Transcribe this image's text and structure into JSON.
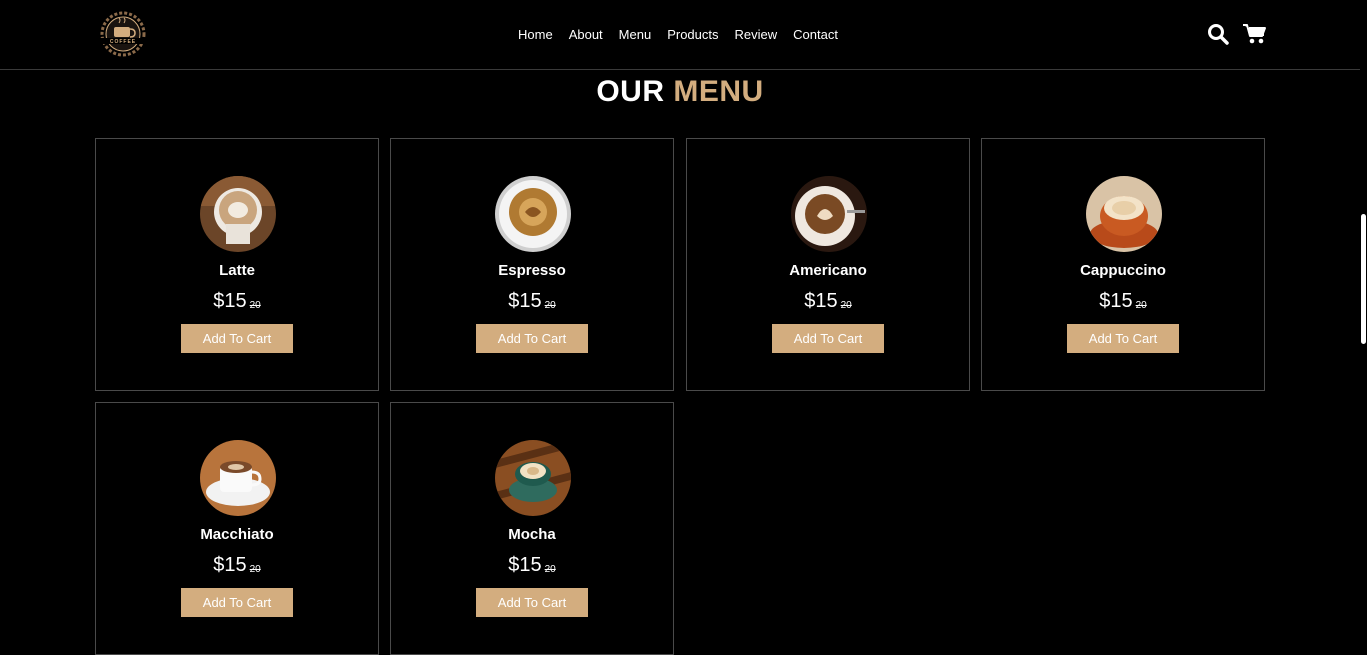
{
  "nav": {
    "links": [
      "Home",
      "About",
      "Menu",
      "Products",
      "Review",
      "Contact"
    ]
  },
  "logo": {
    "brand": "COFFEE"
  },
  "icons": {
    "search": "search-icon",
    "cart": "cart-icon"
  },
  "menu": {
    "title_part1": "OUR",
    "title_part2": "MENU",
    "items": [
      {
        "name": "Latte",
        "price": "$15",
        "old_price": "20",
        "button": "Add To Cart"
      },
      {
        "name": "Espresso",
        "price": "$15",
        "old_price": "20",
        "button": "Add To Cart"
      },
      {
        "name": "Americano",
        "price": "$15",
        "old_price": "20",
        "button": "Add To Cart"
      },
      {
        "name": "Cappuccino",
        "price": "$15",
        "old_price": "20",
        "button": "Add To Cart"
      },
      {
        "name": "Macchiato",
        "price": "$15",
        "old_price": "20",
        "button": "Add To Cart"
      },
      {
        "name": "Mocha",
        "price": "$15",
        "old_price": "20",
        "button": "Add To Cart"
      }
    ]
  },
  "colors": {
    "accent": "#d3ad7f",
    "background": "#000000",
    "border": "#4a4a4a"
  }
}
